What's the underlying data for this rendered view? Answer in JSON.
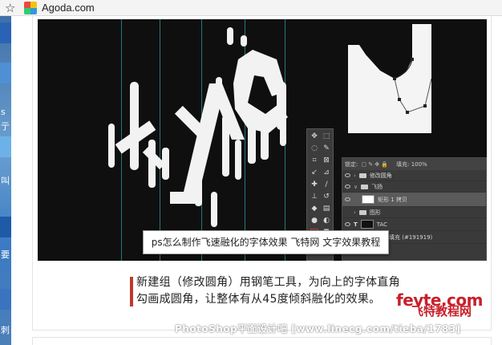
{
  "bookmark_bar": {
    "bookmark_label": "Agoda.com",
    "star_icon": "star-outline-icon",
    "favicon": "agoda-favicon"
  },
  "desktop_strip": {
    "glyphs": [
      "s",
      "亍",
      "叫",
      "要",
      "刺"
    ]
  },
  "image": {
    "tooltip_text": "ps怎么制作飞速融化的字体效果 飞特网 文字效果教程",
    "layers_panel": {
      "lock_label": "锁定:",
      "fill_label": "填充: 100%",
      "layers": [
        {
          "name": "修改圆角",
          "kind": "group"
        },
        {
          "name": "飞扬",
          "kind": "group"
        },
        {
          "name": "矩形 1 拷贝",
          "kind": "layer",
          "selected": true
        },
        {
          "name": "图形",
          "kind": "group"
        },
        {
          "name": "TAC",
          "kind": "text"
        },
        {
          "name": "颜色填充 (#191919)",
          "kind": "fill"
        }
      ]
    }
  },
  "caption": {
    "text": "新建组（修改圆角）用钢笔工具，为向上的字体直角勾画成圆角，让整体有从45度倾斜融化的效果。"
  },
  "watermark": {
    "logo_top": "fevte.com",
    "logo_bottom": "飞特教程网",
    "line": "PhotoShop平面设计吧 [www.linecg.com/tieba/1783]"
  },
  "colors": {
    "accent_red": "#c0392b",
    "watermark_red": "#c7202a",
    "guide_teal": "#2c8a93",
    "canvas_bg": "#0f0f0f"
  }
}
